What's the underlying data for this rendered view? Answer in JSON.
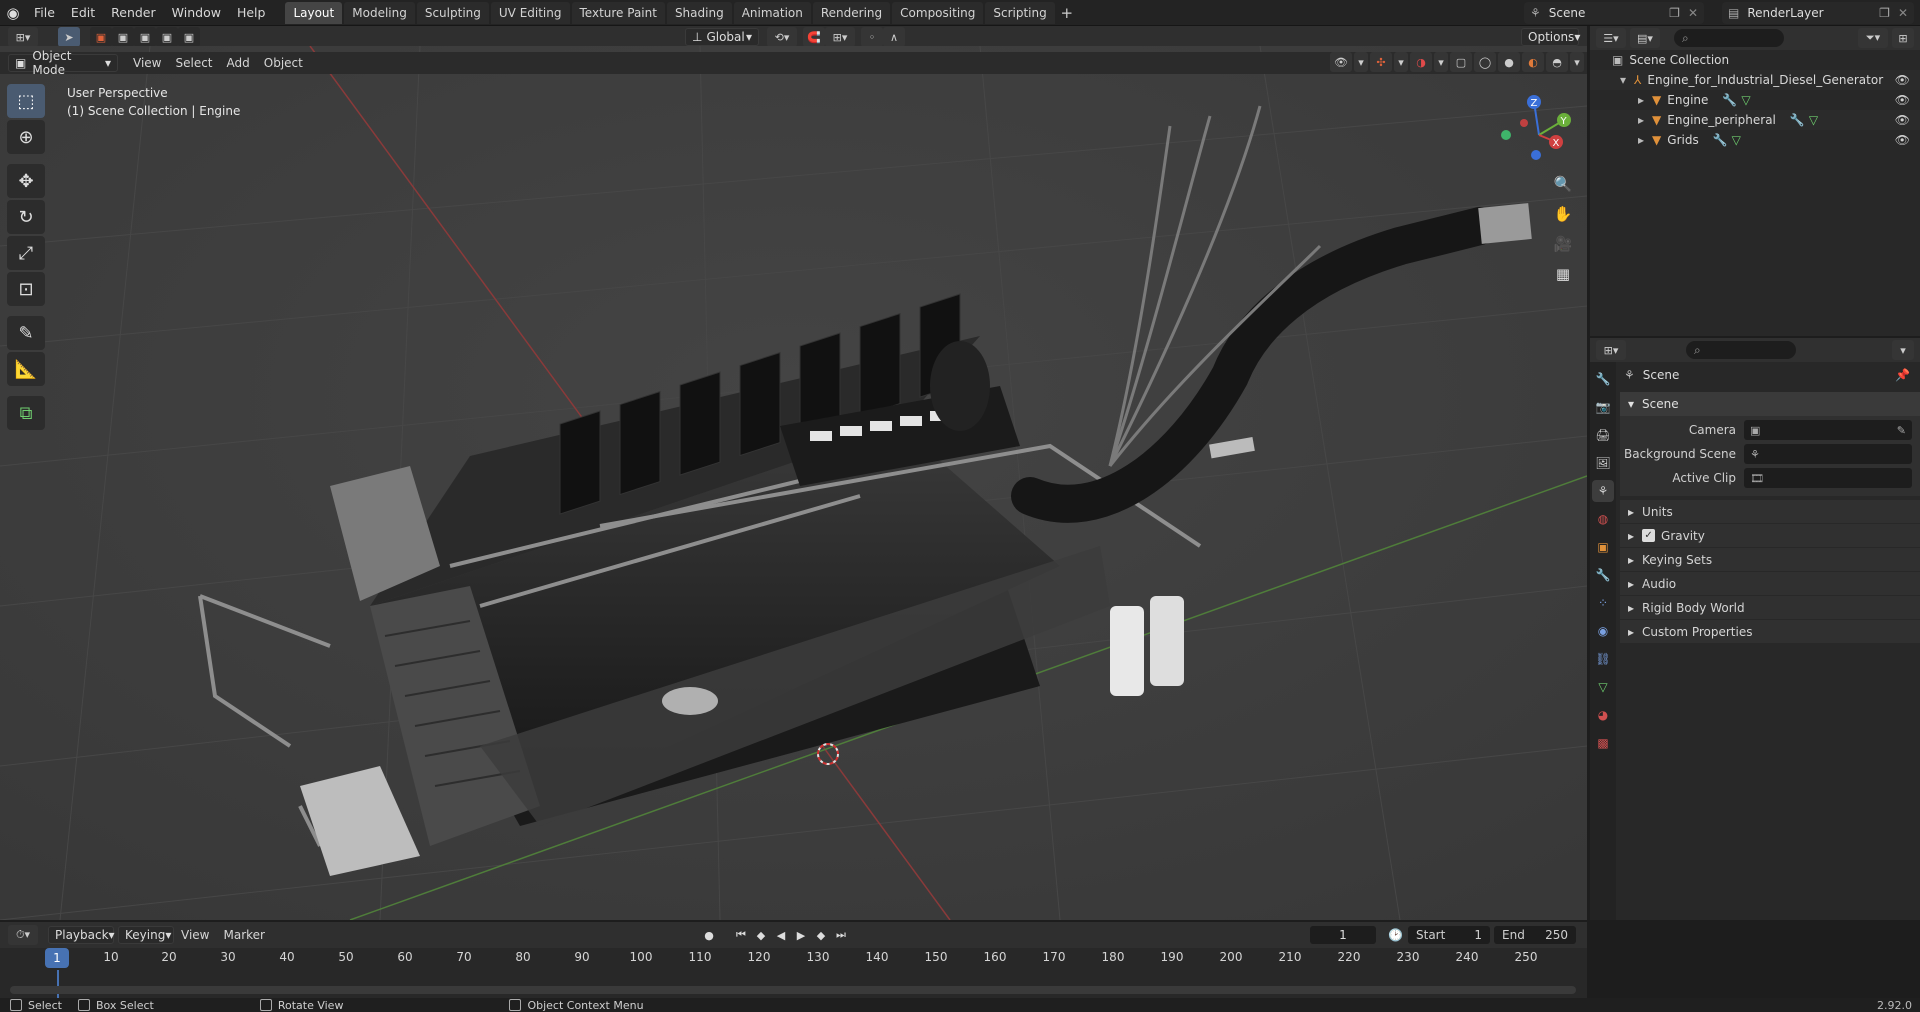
{
  "menu": {
    "items": [
      "File",
      "Edit",
      "Render",
      "Window",
      "Help"
    ]
  },
  "workspaces": [
    {
      "label": "Layout",
      "active": true
    },
    {
      "label": "Modeling",
      "active": false
    },
    {
      "label": "Sculpting",
      "active": false
    },
    {
      "label": "UV Editing",
      "active": false
    },
    {
      "label": "Texture Paint",
      "active": false
    },
    {
      "label": "Shading",
      "active": false
    },
    {
      "label": "Animation",
      "active": false
    },
    {
      "label": "Rendering",
      "active": false
    },
    {
      "label": "Compositing",
      "active": false
    },
    {
      "label": "Scripting",
      "active": false
    }
  ],
  "scene_selector": {
    "value": "Scene"
  },
  "renderlayer_selector": {
    "value": "RenderLayer"
  },
  "viewport_header": {
    "mode": "Object Mode",
    "menus": [
      "View",
      "Select",
      "Add",
      "Object"
    ],
    "orientation": "Global",
    "options": "Options"
  },
  "viewport_info": {
    "line1": "User Perspective",
    "line2": "(1) Scene Collection | Engine"
  },
  "outliner": {
    "root": "Scene Collection",
    "items": [
      {
        "label": "Engine_for_Industrial_Diesel_Generator",
        "level": 1
      },
      {
        "label": "Engine",
        "level": 2
      },
      {
        "label": "Engine_peripheral",
        "level": 2
      },
      {
        "label": "Grids",
        "level": 2
      }
    ]
  },
  "properties": {
    "title": "Scene",
    "panel": "Scene",
    "fields": [
      {
        "label": "Camera"
      },
      {
        "label": "Background Scene"
      },
      {
        "label": "Active Clip"
      }
    ],
    "subpanels": [
      {
        "label": "Units",
        "checkbox": false
      },
      {
        "label": "Gravity",
        "checkbox": true
      },
      {
        "label": "Keying Sets",
        "checkbox": false
      },
      {
        "label": "Audio",
        "checkbox": false
      },
      {
        "label": "Rigid Body World",
        "checkbox": false
      },
      {
        "label": "Custom Properties",
        "checkbox": false
      }
    ]
  },
  "timeline": {
    "menus": [
      "Playback",
      "Keying",
      "View",
      "Marker"
    ],
    "current_frame": "1",
    "start_label": "Start",
    "start": "1",
    "end_label": "End",
    "end": "250",
    "ruler": [
      "10",
      "20",
      "30",
      "40",
      "50",
      "60",
      "70",
      "80",
      "90",
      "100",
      "110",
      "120",
      "130",
      "140",
      "150",
      "160",
      "170",
      "180",
      "190",
      "200",
      "210",
      "220",
      "230",
      "240",
      "250"
    ],
    "cursor": "1"
  },
  "statusbar": {
    "items": [
      "Select",
      "Box Select",
      "Rotate View",
      "Object Context Menu"
    ],
    "version": "2.92.0"
  }
}
